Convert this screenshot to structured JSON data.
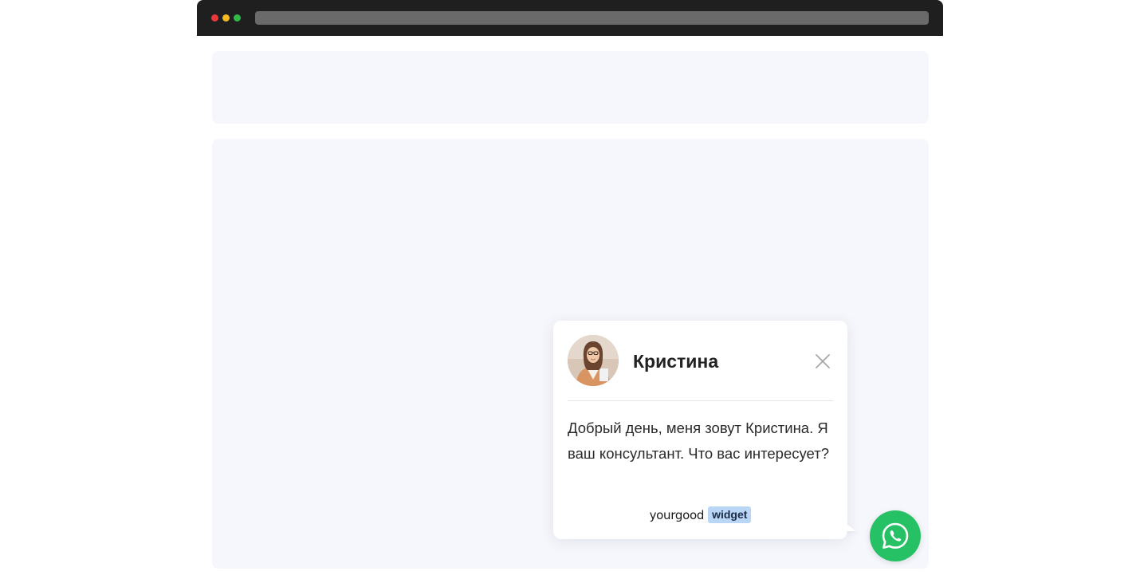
{
  "window": {
    "controls": [
      "close",
      "minimize",
      "maximize"
    ],
    "address_bar": ""
  },
  "chat_widget": {
    "agent_name": "Кристина",
    "message": "Добрый день, меня зовут Кристина. Я ваш консультант. Что вас интересует?",
    "brand_name": "yourgood",
    "brand_tag": "widget",
    "close_icon": "close-icon",
    "launcher_icon": "whatsapp-icon"
  },
  "colors": {
    "titlebar": "#1f1f1f",
    "placeholder_block": "#f6f7fc",
    "whatsapp_green": "#27c165",
    "brand_tag_bg": "#b9d6f6"
  }
}
